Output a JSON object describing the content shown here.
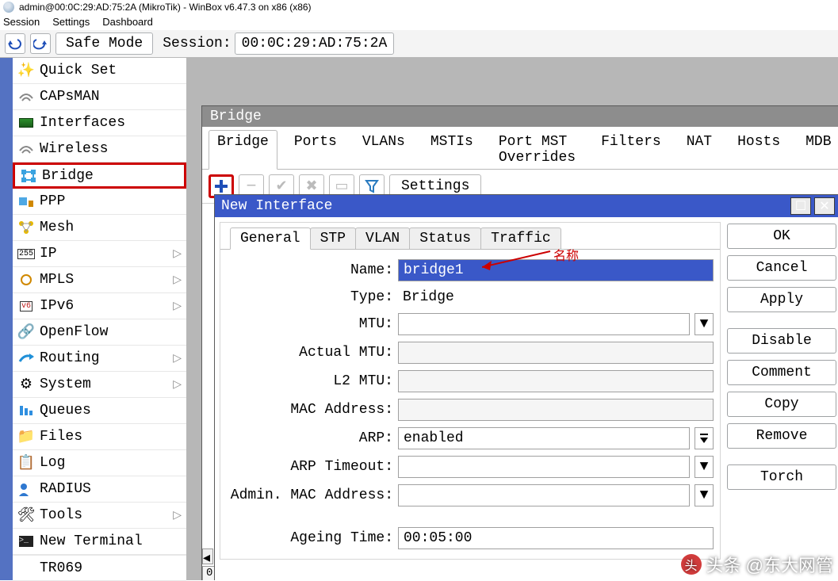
{
  "title": "admin@00:0C:29:AD:75:2A (MikroTik) - WinBox v6.47.3 on x86 (x86)",
  "menu": [
    "Session",
    "Settings",
    "Dashboard"
  ],
  "toolbar": {
    "safe_mode": "Safe Mode",
    "session_label": "Session:",
    "session_value": "00:0C:29:AD:75:2A"
  },
  "sidebar": [
    {
      "label": "Quick Set",
      "icon": "wand"
    },
    {
      "label": "CAPsMAN",
      "icon": "wifi"
    },
    {
      "label": "Interfaces",
      "icon": "iface"
    },
    {
      "label": "Wireless",
      "icon": "wifi"
    },
    {
      "label": "Bridge",
      "icon": "bridge",
      "highlight": true
    },
    {
      "label": "PPP",
      "icon": "ppp"
    },
    {
      "label": "Mesh",
      "icon": "mesh"
    },
    {
      "label": "IP",
      "icon": "ip",
      "sub": true
    },
    {
      "label": "MPLS",
      "icon": "mpls",
      "sub": true
    },
    {
      "label": "IPv6",
      "icon": "ipv6",
      "sub": true
    },
    {
      "label": "OpenFlow",
      "icon": "flow"
    },
    {
      "label": "Routing",
      "icon": "routing",
      "sub": true
    },
    {
      "label": "System",
      "icon": "system",
      "sub": true
    },
    {
      "label": "Queues",
      "icon": "queues"
    },
    {
      "label": "Files",
      "icon": "files"
    },
    {
      "label": "Log",
      "icon": "log"
    },
    {
      "label": "RADIUS",
      "icon": "radius"
    },
    {
      "label": "Tools",
      "icon": "tools",
      "sub": true
    },
    {
      "label": "New Terminal",
      "icon": "terminal"
    },
    {
      "label": "TR069",
      "icon": ""
    }
  ],
  "bridge_win": {
    "title": "Bridge",
    "tabs": [
      "Bridge",
      "Ports",
      "VLANs",
      "MSTIs",
      "Port MST Overrides",
      "Filters",
      "NAT",
      "Hosts",
      "MDB"
    ],
    "active_tab": 0,
    "settings_label": "Settings",
    "status_count": "0"
  },
  "dialog": {
    "title": "New Interface",
    "wincontrols": {
      "min": "☐",
      "close": "✕"
    },
    "tabs": [
      "General",
      "STP",
      "VLAN",
      "Status",
      "Traffic"
    ],
    "active_tab": 0,
    "fields": [
      {
        "label": "Name:",
        "value": "bridge1",
        "type": "text",
        "selected": true
      },
      {
        "label": "Type:",
        "value": "Bridge",
        "type": "readonly"
      },
      {
        "label": "MTU:",
        "value": "",
        "type": "combo"
      },
      {
        "label": "Actual MTU:",
        "value": "",
        "type": "readonly-box"
      },
      {
        "label": "L2 MTU:",
        "value": "",
        "type": "readonly-box"
      },
      {
        "label": "MAC Address:",
        "value": "",
        "type": "readonly-box"
      },
      {
        "label": "ARP:",
        "value": "enabled",
        "type": "select"
      },
      {
        "label": "ARP Timeout:",
        "value": "",
        "type": "combo"
      },
      {
        "label": "Admin. MAC Address:",
        "value": "",
        "type": "combo"
      },
      {
        "label": "Ageing Time:",
        "value": "00:05:00",
        "type": "text"
      }
    ],
    "buttons": [
      "OK",
      "Cancel",
      "Apply",
      "Disable",
      "Comment",
      "Copy",
      "Remove",
      "Torch"
    ]
  },
  "annotation": "名称",
  "watermark": "头条 @东大网管"
}
